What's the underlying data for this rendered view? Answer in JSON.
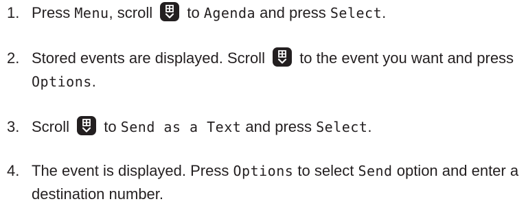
{
  "steps": [
    {
      "number": "1.",
      "parts": [
        {
          "kind": "text",
          "value": "Press "
        },
        {
          "kind": "mono",
          "value": "Menu"
        },
        {
          "kind": "text",
          "value": ", scroll "
        },
        {
          "kind": "icon",
          "value": "nav-key-icon"
        },
        {
          "kind": "text",
          "value": " to "
        },
        {
          "kind": "mono",
          "value": "Agenda"
        },
        {
          "kind": "text",
          "value": " and press "
        },
        {
          "kind": "mono",
          "value": "Select"
        },
        {
          "kind": "text",
          "value": "."
        }
      ]
    },
    {
      "number": "2.",
      "parts": [
        {
          "kind": "text",
          "value": "Stored events are displayed. Scroll "
        },
        {
          "kind": "icon",
          "value": "nav-key-icon"
        },
        {
          "kind": "text",
          "value": " to the event you want and press "
        },
        {
          "kind": "mono",
          "value": "Options"
        },
        {
          "kind": "text",
          "value": "."
        }
      ]
    },
    {
      "number": "3.",
      "parts": [
        {
          "kind": "text",
          "value": "Scroll "
        },
        {
          "kind": "icon",
          "value": "nav-key-icon"
        },
        {
          "kind": "text",
          "value": " to "
        },
        {
          "kind": "mono",
          "value": "Send as a Text"
        },
        {
          "kind": "text",
          "value": " and press "
        },
        {
          "kind": "mono",
          "value": "Select"
        },
        {
          "kind": "text",
          "value": "."
        }
      ]
    },
    {
      "number": "4.",
      "parts": [
        {
          "kind": "text",
          "value": "The event is displayed. Press "
        },
        {
          "kind": "mono",
          "value": "Options"
        },
        {
          "kind": "text",
          "value": " to select "
        },
        {
          "kind": "mono",
          "value": "Send"
        },
        {
          "kind": "text",
          "value": " option and enter a destination number."
        }
      ]
    }
  ],
  "colors": {
    "text": "#231f20",
    "key_fill": "#231f20",
    "key_glyph": "#ffffff"
  }
}
